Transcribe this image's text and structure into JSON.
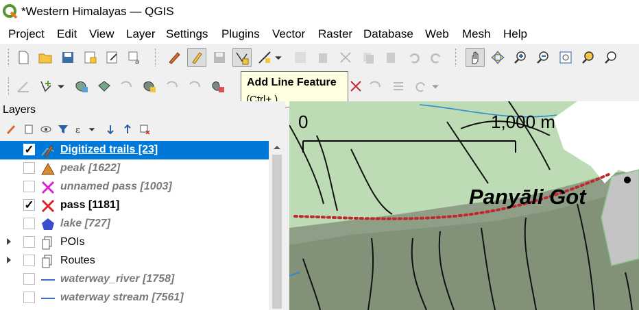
{
  "window": {
    "title": "*Western Himalayas — QGIS"
  },
  "menu": [
    "Project",
    "Edit",
    "View",
    "Layer",
    "Settings",
    "Plugins",
    "Vector",
    "Raster",
    "Database",
    "Web",
    "Mesh",
    "Help"
  ],
  "tooltip": {
    "title": "Add Line Feature",
    "shortcut": "(Ctrl+.)"
  },
  "layers_panel": {
    "title": "Layers",
    "layers": [
      {
        "name": "Digitized trails [23]",
        "checked": true,
        "selected": true,
        "icon": "line-edit-icon"
      },
      {
        "name": "peak [1622]",
        "checked": false,
        "icon": "triangle-icon"
      },
      {
        "name": "unnamed pass [1003]",
        "checked": false,
        "icon": "magenta-x-icon"
      },
      {
        "name": "pass [1181]",
        "checked": true,
        "icon": "red-x-icon"
      },
      {
        "name": "lake [727]",
        "checked": false,
        "icon": "pentagon-icon"
      },
      {
        "name": "POIs",
        "checked": false,
        "group": true,
        "icon": "group-icon"
      },
      {
        "name": "Routes",
        "checked": false,
        "group": true,
        "icon": "group-icon"
      },
      {
        "name": "waterway_river [1758]",
        "checked": false,
        "icon": "blue-line-icon"
      },
      {
        "name": "waterway stream [7561]",
        "checked": false,
        "icon": "blue-line-icon"
      }
    ]
  },
  "map": {
    "scalebar": {
      "start_label": "0",
      "end_label": "1,000 m"
    },
    "place_label": "Panyāli  Got"
  },
  "colors": {
    "selection": "#0078d7",
    "trail_red": "#c0282d",
    "terrain_green": "#b8dcb0"
  }
}
